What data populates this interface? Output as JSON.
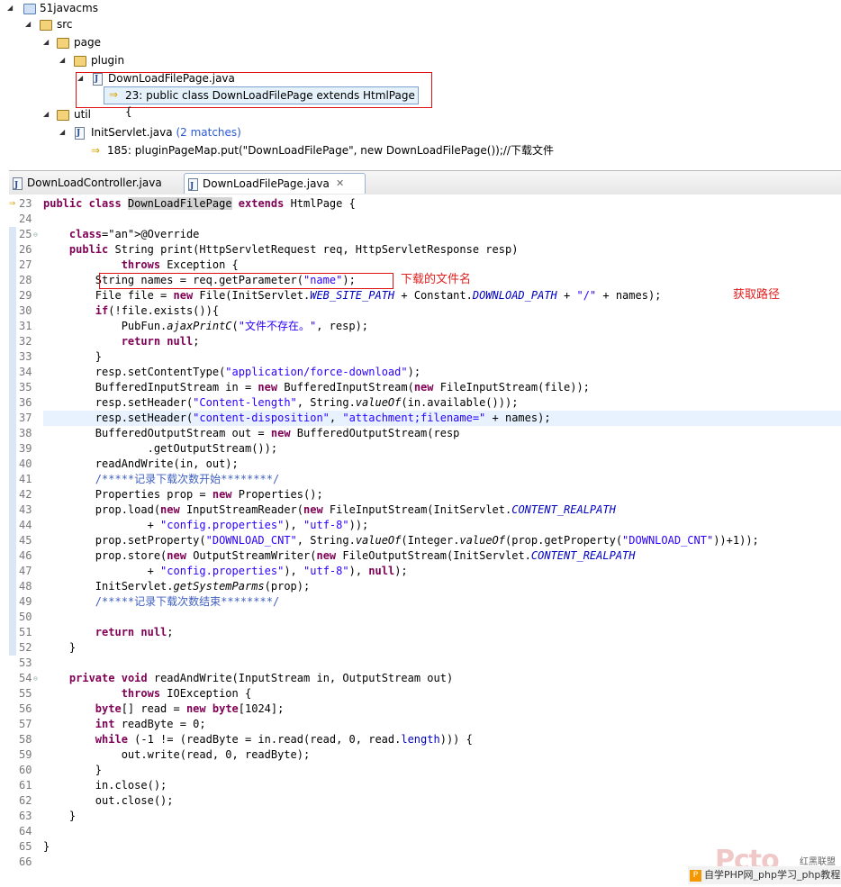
{
  "search_tree": {
    "project": "51javacms",
    "src": "src",
    "page": "page",
    "plugin": "plugin",
    "file1": "DownLoadFilePage.java",
    "match1": "23: public class DownLoadFilePage extends HtmlPage {",
    "util": "util",
    "file2": "InitServlet.java",
    "file2_matches": "(2 matches)",
    "match2": "185: pluginPageMap.put(\"DownLoadFilePage\", new DownLoadFilePage());//下载文件"
  },
  "tabs": [
    {
      "label": "DownLoadController.java",
      "active": false
    },
    {
      "label": "DownLoadFilePage.java",
      "active": true
    }
  ],
  "tab_close_glyph": "✕",
  "editor": {
    "current_line": 37,
    "lines": [
      {
        "n": "23",
        "t": "public class DownLoadFilePage extends HtmlPage {"
      },
      {
        "n": "24",
        "t": ""
      },
      {
        "n": "25",
        "t": "    @Override"
      },
      {
        "n": "26",
        "t": "    public String print(HttpServletRequest req, HttpServletResponse resp)"
      },
      {
        "n": "27",
        "t": "            throws Exception {"
      },
      {
        "n": "28",
        "t": "        String names = req.getParameter(\"name\");"
      },
      {
        "n": "29",
        "t": "        File file = new File(InitServlet.WEB_SITE_PATH + Constant.DOWNLOAD_PATH + \"/\" + names);"
      },
      {
        "n": "30",
        "t": "        if(!file.exists()){"
      },
      {
        "n": "31",
        "t": "            PubFun.ajaxPrintC(\"文件不存在。\", resp);"
      },
      {
        "n": "32",
        "t": "            return null;"
      },
      {
        "n": "33",
        "t": "        }"
      },
      {
        "n": "34",
        "t": "        resp.setContentType(\"application/force-download\");"
      },
      {
        "n": "35",
        "t": "        BufferedInputStream in = new BufferedInputStream(new FileInputStream(file));"
      },
      {
        "n": "36",
        "t": "        resp.setHeader(\"Content-length\", String.valueOf(in.available()));"
      },
      {
        "n": "37",
        "t": "        resp.setHeader(\"content-disposition\", \"attachment;filename=\" + names);"
      },
      {
        "n": "38",
        "t": "        BufferedOutputStream out = new BufferedOutputStream(resp"
      },
      {
        "n": "39",
        "t": "                .getOutputStream());"
      },
      {
        "n": "40",
        "t": "        readAndWrite(in, out);"
      },
      {
        "n": "41",
        "t": "        /*****记录下载次数开始********/"
      },
      {
        "n": "42",
        "t": "        Properties prop = new Properties();"
      },
      {
        "n": "43",
        "t": "        prop.load(new InputStreamReader(new FileInputStream(InitServlet.CONTENT_REALPATH"
      },
      {
        "n": "44",
        "t": "                + \"config.properties\"), \"utf-8\"));"
      },
      {
        "n": "45",
        "t": "        prop.setProperty(\"DOWNLOAD_CNT\", String.valueOf(Integer.valueOf(prop.getProperty(\"DOWNLOAD_CNT\"))+1));"
      },
      {
        "n": "46",
        "t": "        prop.store(new OutputStreamWriter(new FileOutputStream(InitServlet.CONTENT_REALPATH"
      },
      {
        "n": "47",
        "t": "                + \"config.properties\"), \"utf-8\"), null);"
      },
      {
        "n": "48",
        "t": "        InitServlet.getSystemParms(prop);"
      },
      {
        "n": "49",
        "t": "        /*****记录下载次数结束********/"
      },
      {
        "n": "50",
        "t": ""
      },
      {
        "n": "51",
        "t": "        return null;"
      },
      {
        "n": "52",
        "t": "    }"
      },
      {
        "n": "53",
        "t": ""
      },
      {
        "n": "54",
        "t": "    private void readAndWrite(InputStream in, OutputStream out)"
      },
      {
        "n": "55",
        "t": "            throws IOException {"
      },
      {
        "n": "56",
        "t": "        byte[] read = new byte[1024];"
      },
      {
        "n": "57",
        "t": "        int readByte = 0;"
      },
      {
        "n": "58",
        "t": "        while (-1 != (readByte = in.read(read, 0, read.length))) {"
      },
      {
        "n": "59",
        "t": "            out.write(read, 0, readByte);"
      },
      {
        "n": "60",
        "t": "        }"
      },
      {
        "n": "61",
        "t": "        in.close();"
      },
      {
        "n": "62",
        "t": "        out.close();"
      },
      {
        "n": "63",
        "t": "    }"
      },
      {
        "n": "64",
        "t": ""
      },
      {
        "n": "65",
        "t": "}"
      },
      {
        "n": "66",
        "t": ""
      }
    ]
  },
  "annotations": {
    "download_filename": "下载的文件名",
    "get_path": "获取路径"
  },
  "watermark": {
    "logo_text": "Pcto",
    "brand": "红黑联盟",
    "bar_text": "自学PHP网_php学习_php教程"
  },
  "colors": {
    "keyword": "#7f0055",
    "string": "#2a00ff",
    "comment": "#3f5fbf",
    "static_field": "#0000c0",
    "annotation": "#646464",
    "annotation_note": "#e02020"
  }
}
